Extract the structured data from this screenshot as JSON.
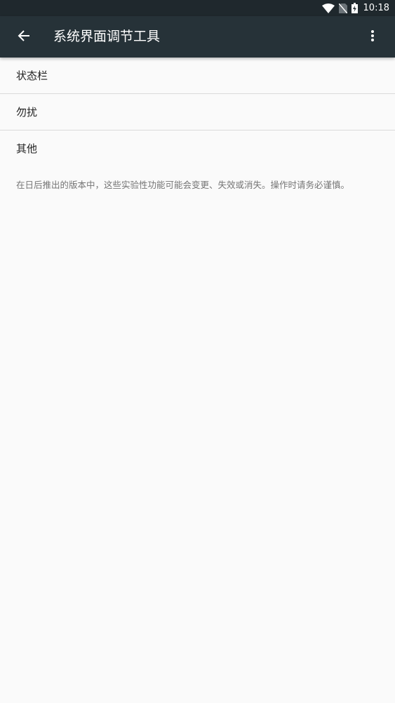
{
  "status_bar": {
    "time": "10:18",
    "icons": [
      "wifi-icon",
      "no-sim-icon",
      "battery-charging-icon"
    ]
  },
  "app_bar": {
    "title": "系统界面调节工具",
    "back_icon": "arrow-back-icon",
    "overflow_icon": "more-vert-icon"
  },
  "list": {
    "items": [
      {
        "label": "状态栏"
      },
      {
        "label": "勿扰"
      },
      {
        "label": "其他"
      }
    ]
  },
  "footer_note": "在日后推出的版本中，这些实验性功能可能会变更、失效或消失。操作时请务必谨慎。",
  "colors": {
    "status_bar_bg": "#1f282d",
    "app_bar_bg": "#263238",
    "page_bg": "#fafafa",
    "text_primary": "#212121",
    "text_secondary": "#757575",
    "divider": "#dadada"
  }
}
